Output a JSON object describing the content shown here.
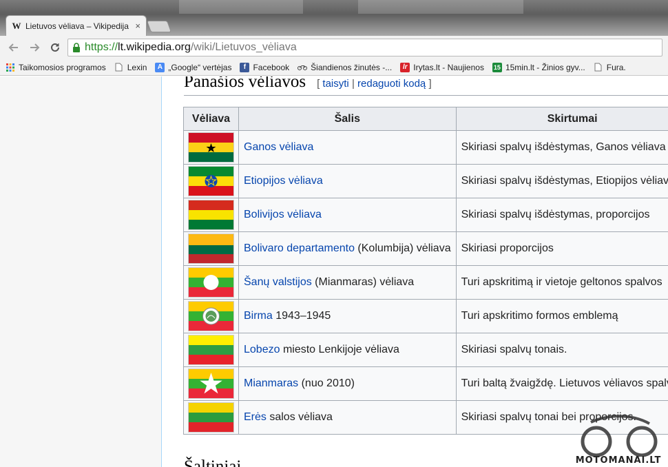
{
  "browser": {
    "tab_title": "Lietuvos vėliava – Vikipedija",
    "tab_close": "×",
    "url_scheme": "https://",
    "url_host": "lt.wikipedia.org",
    "url_path": "/wiki/Lietuvos_vėliava",
    "bookmarks": [
      {
        "label": "Taikomosios programos",
        "icon": "apps-grid-icon"
      },
      {
        "label": "Lexin",
        "icon": "page-icon"
      },
      {
        "label": "„Google“ vertėjas",
        "icon": "google-translate-icon"
      },
      {
        "label": "Facebook",
        "icon": "facebook-icon"
      },
      {
        "label": "Šiandienos žinutės -...",
        "icon": "bicycle-icon"
      },
      {
        "label": "Irytas.lt - Naujienos",
        "icon": "lr-icon"
      },
      {
        "label": "15min.lt - Žinios gyv...",
        "icon": "15min-icon"
      },
      {
        "label": "Fura.",
        "icon": "page-icon"
      }
    ]
  },
  "article": {
    "section_title": "Panašios vėliavos",
    "edit_open": "[",
    "edit_link": "taisyti",
    "edit_separator": "|",
    "edit_source_link": "redaguoti kodą",
    "edit_close": "]",
    "table": {
      "headers": [
        "Vėliava",
        "Šalis",
        "Skirtumai"
      ],
      "rows": [
        {
          "flag": "ghana",
          "link": "Ganos vėliava",
          "rest": "",
          "diff": "Skiriasi spalvų išdėstymas, Ganos vėliava"
        },
        {
          "flag": "ethiopia",
          "link": "Etiopijos vėliava",
          "rest": "",
          "diff": "Skiriasi spalvų išdėstymas, Etiopijos vėliava"
        },
        {
          "flag": "bolivia",
          "link": "Bolivijos vėliava",
          "rest": "",
          "diff": "Skiriasi spalvų išdėstymas, proporcijos"
        },
        {
          "flag": "bolivar",
          "link": "Bolivaro departamento",
          "rest": " (Kolumbija) vėliava",
          "diff": "Skiriasi proporcijos"
        },
        {
          "flag": "shan",
          "link": "Šanų valstijos",
          "rest": " (Mianmaras) vėliava",
          "diff": "Turi apskritimą ir vietoje geltonos spalvos"
        },
        {
          "flag": "burma",
          "link": "Birma",
          "rest": " 1943–1945",
          "diff": "Turi apskritimo formos emblemą"
        },
        {
          "flag": "lobez",
          "link": "Lobezo",
          "rest": " miesto Lenkijoje vėliava",
          "diff": "Skiriasi spalvų tonais."
        },
        {
          "flag": "myanmar",
          "link": "Mianmaras",
          "rest": " (nuo 2010)",
          "diff": "Turi baltą žvaigždę. Lietuvos vėliavos spalvos"
        },
        {
          "flag": "eres",
          "link": "Erės",
          "rest": " salos vėliava",
          "diff": "Skiriasi spalvų tonai bei proporcijos."
        }
      ]
    },
    "next_section_title": "Šaltiniai"
  },
  "watermark": {
    "text": "MOTOMANAI.LT"
  },
  "colors": {
    "link": "#0645ad",
    "secure_green": "#2a8b2a",
    "flag_yellow": "#fdb913",
    "flag_green": "#006a44",
    "flag_red": "#c1272d"
  }
}
